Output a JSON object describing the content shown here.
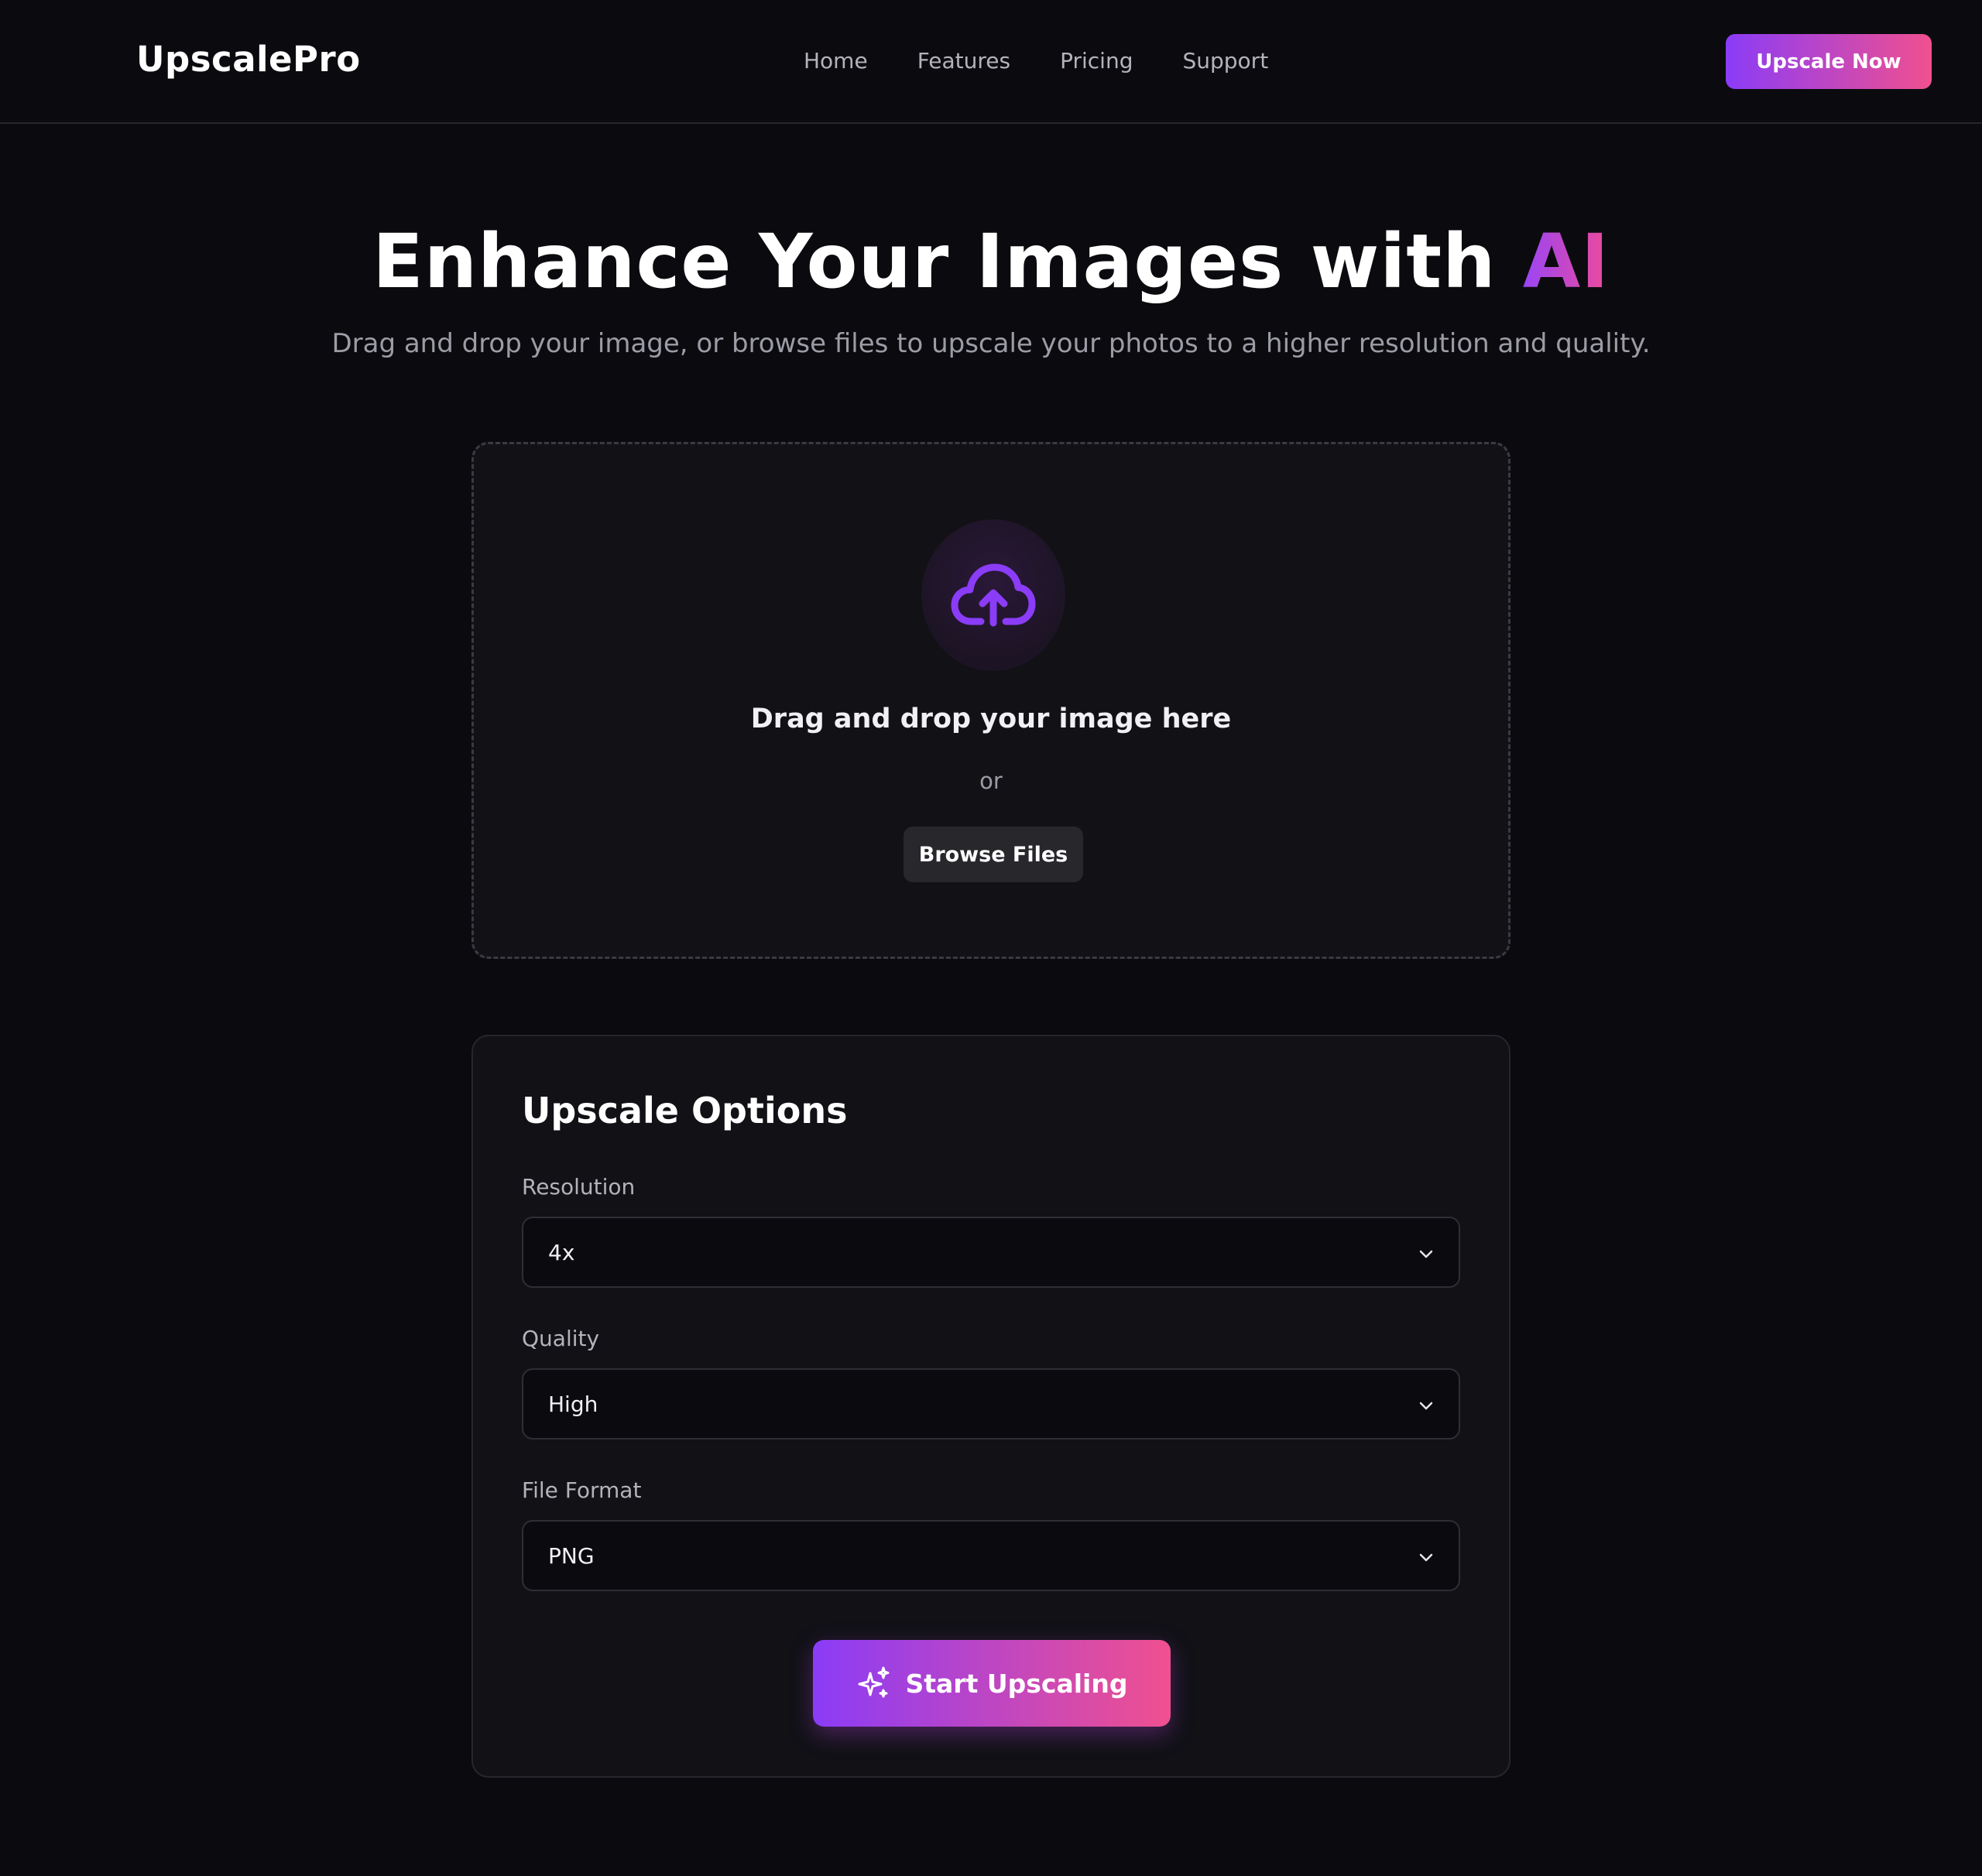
{
  "header": {
    "logo": "UpscalePro",
    "nav": [
      "Home",
      "Features",
      "Pricing",
      "Support"
    ],
    "cta_label": "Upscale Now"
  },
  "hero": {
    "title_main": "Enhance Your Images with ",
    "title_accent": "AI",
    "subtitle": "Drag and drop your image, or browse files to upscale your photos to a higher resolution and quality."
  },
  "dropzone": {
    "icon": "cloud-upload-icon",
    "title": "Drag and drop your image here",
    "or_text": "or",
    "browse_label": "Browse Files"
  },
  "options": {
    "title": "Upscale Options",
    "resolution": {
      "label": "Resolution",
      "value": "4x"
    },
    "quality": {
      "label": "Quality",
      "value": "High"
    },
    "format": {
      "label": "File Format",
      "value": "PNG"
    },
    "start_label": "Start Upscaling",
    "start_icon": "sparkles-icon"
  },
  "colors": {
    "background": "#0b0b0f",
    "card": "#111116",
    "accent_start": "#8b3cf7",
    "accent_end": "#f0508f",
    "icon_purple": "#8b3cf7"
  }
}
